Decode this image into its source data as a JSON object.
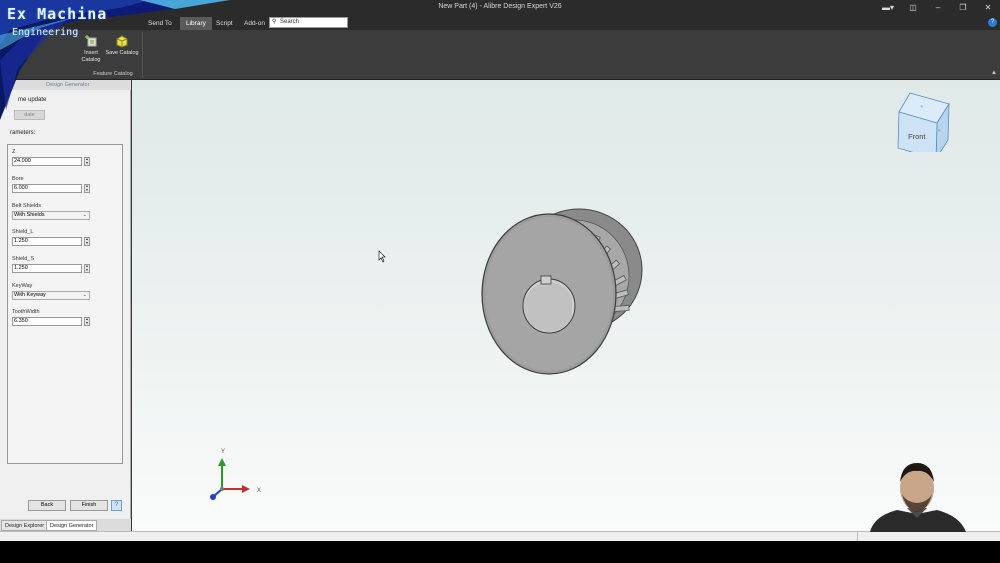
{
  "window": {
    "title": "New Part (4) - Alibre Design Expert V26"
  },
  "tabs": [
    {
      "label": "Send To"
    },
    {
      "label": "Library"
    },
    {
      "label": "Script"
    },
    {
      "label": "Add-on"
    }
  ],
  "search": {
    "placeholder": "Search"
  },
  "ribbon": {
    "insert_catalog": "Insert Catalog",
    "save_catalog": "Save Catalog",
    "group_label": "Feature Catalog"
  },
  "panel": {
    "header": "Design Generator",
    "realtime_label": "me update",
    "update_label": "date",
    "parameters_label": "rameters:",
    "params": [
      {
        "label": "Z",
        "value": "24.000",
        "kind": "number"
      },
      {
        "label": "Bore",
        "value": "6.000",
        "kind": "number"
      },
      {
        "label": "Belt Shields",
        "value": "With Shields",
        "kind": "select"
      },
      {
        "label": "Shield_L",
        "value": "1.250",
        "kind": "number"
      },
      {
        "label": "Shield_S",
        "value": "1.250",
        "kind": "number"
      },
      {
        "label": "KeyWay",
        "value": "With Keyway",
        "kind": "select"
      },
      {
        "label": "ToothWidth",
        "value": "6.350",
        "kind": "number"
      }
    ],
    "back_label": "Back",
    "finish_label": "Finish",
    "help_label": "?",
    "tab_explorer": "Design Explorer",
    "tab_generator": "Design Generator"
  },
  "viewcube": {
    "face_label": "Front"
  },
  "axes": {
    "x_label": "X",
    "y_label": "Y"
  },
  "logo": {
    "line1": "Ex Machina",
    "line2": "Engineering"
  },
  "colors": {
    "accent": "#2e7bd6",
    "part_gray": "#9c9c9c",
    "cube_blue": "#cfe3f6"
  }
}
